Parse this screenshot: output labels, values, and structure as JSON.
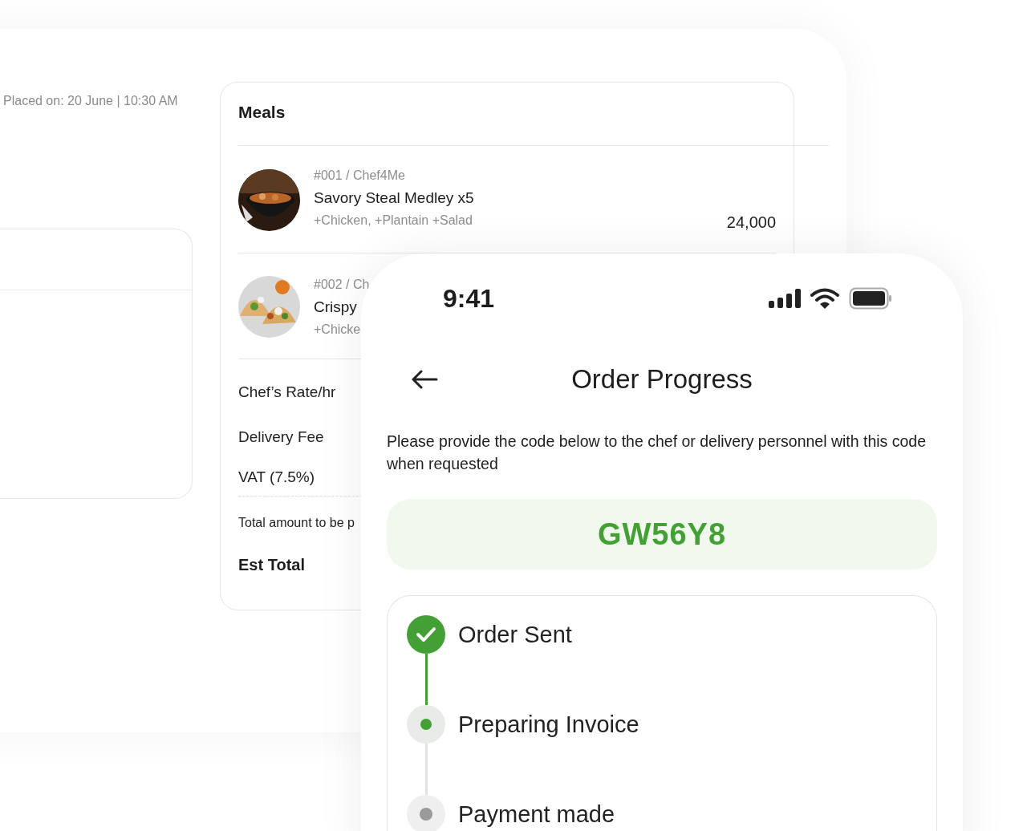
{
  "order_card": {
    "placed_on": "Placed on: 20 June | 10:30 AM",
    "meals": {
      "title": "Meals",
      "items": [
        {
          "ref": "#001 / Chef4Me",
          "name": "Savory Steal Medley x5",
          "extras": "+Chicken, +Plantain +Salad",
          "price": "24,000",
          "kind": "bowl"
        },
        {
          "ref": "#002 / Ch",
          "name": "Crispy",
          "extras": "+Chicke",
          "kind": "tacos"
        }
      ],
      "fees": [
        "Chef’s Rate/hr",
        "Delivery Fee",
        "VAT (7.5%)"
      ],
      "total_note": "Total amount to be p",
      "est_total": "Est Total"
    }
  },
  "phone": {
    "time": "9:41",
    "title": "Order Progress",
    "instruction": "Please provide the code below to the chef or delivery personnel with this code when requested",
    "code": "GW56Y8",
    "steps": [
      {
        "label": "Order Sent",
        "kind": "done"
      },
      {
        "label": "Preparing Invoice",
        "kind": "current"
      },
      {
        "label": "Payment made",
        "kind": "pending"
      }
    ]
  }
}
